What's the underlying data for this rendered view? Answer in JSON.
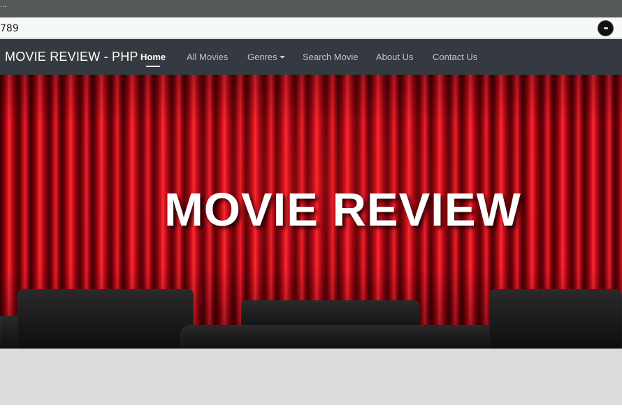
{
  "browser": {
    "tab_fragment": "...",
    "address": "789"
  },
  "navbar": {
    "brand": "MOVIE REVIEW - PHP",
    "items": [
      {
        "label": "Home",
        "active": true
      },
      {
        "label": "All Movies"
      },
      {
        "label": "Genres",
        "dropdown": true
      },
      {
        "label": "Search Movie"
      },
      {
        "label": "About Us"
      },
      {
        "label": "Contact Us"
      }
    ]
  },
  "hero": {
    "title": "MOVIE REVIEW"
  },
  "icons": {
    "profile": "profile-avatar-icon",
    "dropdown": "caret-down-icon"
  },
  "colors": {
    "navbar_bg": "#343a40",
    "curtain_red": "#c8101c",
    "page_bg": "#dcdcdc"
  }
}
